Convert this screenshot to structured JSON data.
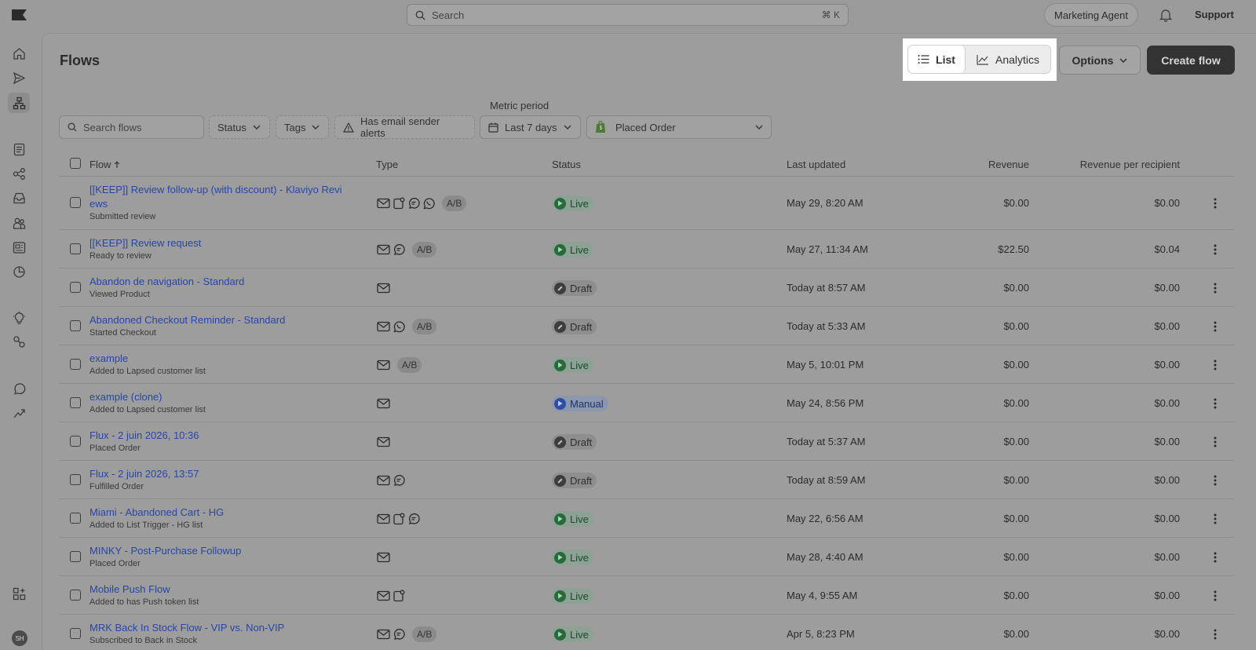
{
  "topbar": {
    "search_placeholder": "Search",
    "search_shortcut": "⌘ K",
    "agent_label": "Marketing Agent",
    "support_label": "Support"
  },
  "sidebar": {
    "icons": [
      "home-icon",
      "send-icon",
      "flows-icon",
      "list-icon",
      "segments-icon",
      "inbox-icon",
      "audience-icon",
      "content-icon",
      "analytics-clock-icon",
      "idea-icon",
      "integrations-icon",
      "whatsapp-icon",
      "trend-icon",
      "apps-icon"
    ],
    "avatar_initials": "SH"
  },
  "header": {
    "title": "Flows",
    "view_toggle": {
      "list_label": "List",
      "analytics_label": "Analytics",
      "selected": "List"
    },
    "options_label": "Options",
    "create_label": "Create flow"
  },
  "filters": {
    "search_placeholder": "Search flows",
    "status_label": "Status",
    "tags_label": "Tags",
    "alerts_label": "Has email sender alerts",
    "metric_period_label": "Metric period",
    "period_value": "Last 7 days",
    "metric_value": "Placed Order"
  },
  "table": {
    "columns": {
      "flow": "Flow",
      "type": "Type",
      "status": "Status",
      "last_updated": "Last updated",
      "revenue": "Revenue",
      "rpr": "Revenue per recipient"
    },
    "rows": [
      {
        "name_line1": "[[KEEP]] Review follow-up (with discount) - Klaviyo Revi",
        "name_line2": "ews",
        "trigger": "Submitted review",
        "types": [
          "email",
          "push",
          "sms",
          "whatsapp"
        ],
        "ab": true,
        "status": "Live",
        "updated": "May 29, 8:20 AM",
        "revenue": "$0.00",
        "rpr": "$0.00"
      },
      {
        "name_line1": "[[KEEP]] Review request",
        "name_line2": "",
        "trigger": "Ready to review",
        "types": [
          "email",
          "sms"
        ],
        "ab": true,
        "status": "Live",
        "updated": "May 27, 11:34 AM",
        "revenue": "$22.50",
        "rpr": "$0.04"
      },
      {
        "name_line1": "Abandon de navigation - Standard",
        "name_line2": "",
        "trigger": "Viewed Product",
        "types": [
          "email"
        ],
        "ab": false,
        "status": "Draft",
        "updated": "Today at 8:57 AM",
        "revenue": "$0.00",
        "rpr": "$0.00"
      },
      {
        "name_line1": "Abandoned Checkout Reminder - Standard",
        "name_line2": "",
        "trigger": "Started Checkout",
        "types": [
          "email",
          "whatsapp"
        ],
        "ab": true,
        "status": "Draft",
        "updated": "Today at 5:33 AM",
        "revenue": "$0.00",
        "rpr": "$0.00"
      },
      {
        "name_line1": "example",
        "name_line2": "",
        "trigger": "Added to Lapsed customer list",
        "types": [
          "email"
        ],
        "ab": true,
        "status": "Live",
        "updated": "May 5, 10:01 PM",
        "revenue": "$0.00",
        "rpr": "$0.00"
      },
      {
        "name_line1": "example (clone)",
        "name_line2": "",
        "trigger": "Added to Lapsed customer list",
        "types": [
          "email"
        ],
        "ab": false,
        "status": "Manual",
        "updated": "May 24, 8:56 PM",
        "revenue": "$0.00",
        "rpr": "$0.00"
      },
      {
        "name_line1": "Flux - 2 juin 2026, 10:36",
        "name_line2": "",
        "trigger": "Placed Order",
        "types": [
          "email"
        ],
        "ab": false,
        "status": "Draft",
        "updated": "Today at 5:37 AM",
        "revenue": "$0.00",
        "rpr": "$0.00"
      },
      {
        "name_line1": "Flux - 2 juin 2026, 13:57",
        "name_line2": "",
        "trigger": "Fulfilled Order",
        "types": [
          "email",
          "sms"
        ],
        "ab": false,
        "status": "Draft",
        "updated": "Today at 8:59 AM",
        "revenue": "$0.00",
        "rpr": "$0.00"
      },
      {
        "name_line1": "Miami - Abandoned Cart - HG",
        "name_line2": "",
        "trigger": "Added to List Trigger - HG list",
        "types": [
          "email",
          "push",
          "sms"
        ],
        "ab": false,
        "status": "Live",
        "updated": "May 22, 6:56 AM",
        "revenue": "$0.00",
        "rpr": "$0.00"
      },
      {
        "name_line1": "MINKY - Post-Purchase Followup",
        "name_line2": "",
        "trigger": "Placed Order",
        "types": [
          "email"
        ],
        "ab": false,
        "status": "Live",
        "updated": "May 28, 4:40 AM",
        "revenue": "$0.00",
        "rpr": "$0.00"
      },
      {
        "name_line1": "Mobile Push Flow",
        "name_line2": "",
        "trigger": "Added to has Push token list",
        "types": [
          "email",
          "push"
        ],
        "ab": false,
        "status": "Live",
        "updated": "May 4, 9:55 AM",
        "revenue": "$0.00",
        "rpr": "$0.00"
      },
      {
        "name_line1": "MRK Back In Stock Flow - VIP vs. Non-VIP",
        "name_line2": "",
        "trigger": "Subscribed to Back in Stock",
        "types": [
          "email",
          "sms"
        ],
        "ab": true,
        "status": "Live",
        "updated": "Apr 5, 8:23 PM",
        "revenue": "$0.00",
        "rpr": "$0.00"
      }
    ]
  }
}
